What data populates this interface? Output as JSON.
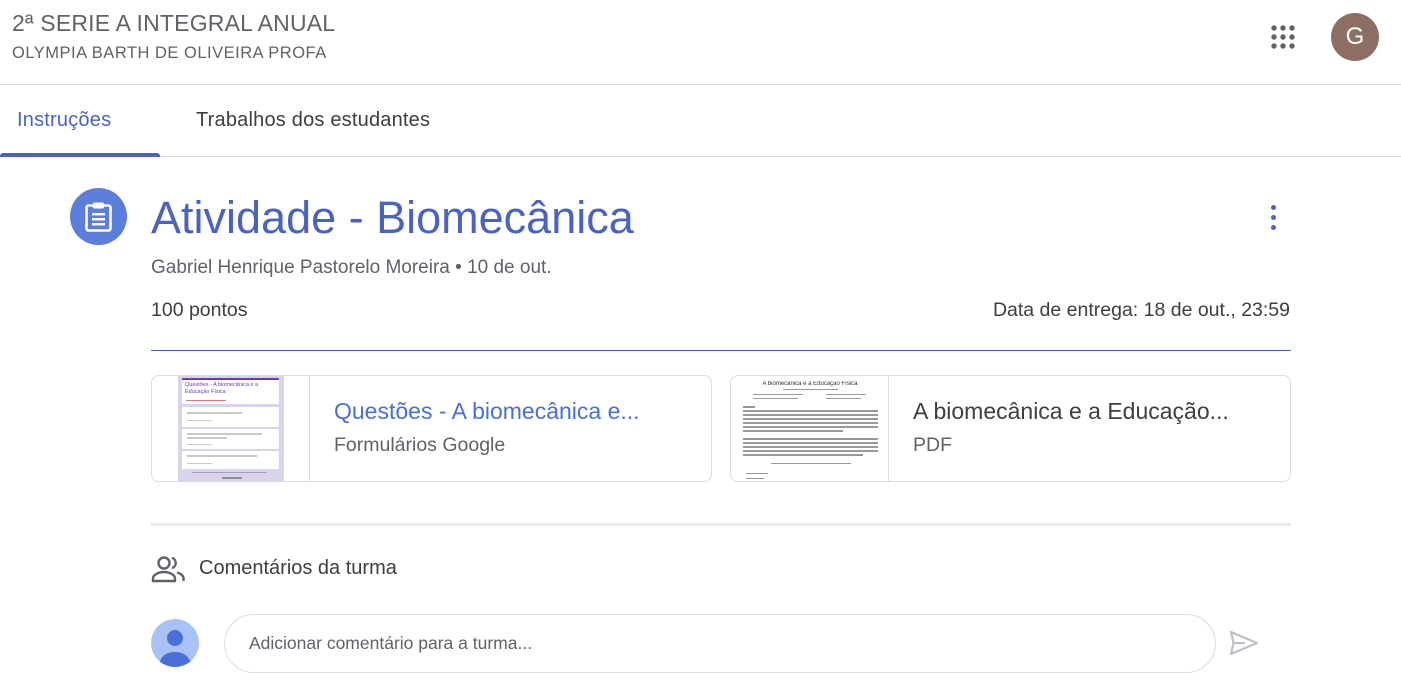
{
  "header": {
    "course_title": "2ª SERIE A INTEGRAL ANUAL",
    "course_subtitle": "OLYMPIA BARTH DE OLIVEIRA PROFA",
    "apps_icon": "apps-grid-icon",
    "account_initial": "G",
    "account_color": "#8d6e63"
  },
  "tabs": [
    {
      "label": "Instruções",
      "active": true
    },
    {
      "label": "Trabalhos dos estudantes",
      "active": false
    }
  ],
  "assignment": {
    "icon": "assignment-clipboard-icon",
    "title": "Atividade - Biomecânica",
    "meta": "Gabriel Henrique Pastorelo Moreira • 10 de out.",
    "points": "100 pontos",
    "due": "Data de entrega: 18 de out., 23:59",
    "accent_color": "#4a63c3"
  },
  "attachments": [
    {
      "title": "Questões - A biomecânica e...",
      "type": "Formulários Google",
      "thumb_title": "Questões - A biomecânica e a Educação Física"
    },
    {
      "title": "A biomecânica e a Educação...",
      "type": "PDF",
      "thumb_title": "A biomecânica e a Educação Física"
    }
  ],
  "comments": {
    "icon": "people-icon",
    "title": "Comentários da turma",
    "placeholder": "Adicionar comentário para a turma...",
    "send_icon": "send-icon"
  }
}
